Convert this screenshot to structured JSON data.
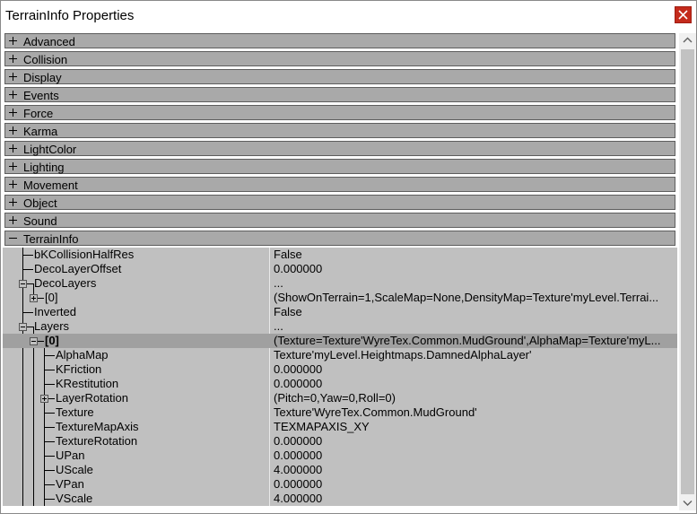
{
  "window": {
    "title": "TerrainInfo Properties"
  },
  "categories": [
    {
      "label": "Advanced",
      "expanded": false
    },
    {
      "label": "Collision",
      "expanded": false
    },
    {
      "label": "Display",
      "expanded": false
    },
    {
      "label": "Events",
      "expanded": false
    },
    {
      "label": "Force",
      "expanded": false
    },
    {
      "label": "Karma",
      "expanded": false
    },
    {
      "label": "LightColor",
      "expanded": false
    },
    {
      "label": "Lighting",
      "expanded": false
    },
    {
      "label": "Movement",
      "expanded": false
    },
    {
      "label": "Object",
      "expanded": false
    },
    {
      "label": "Sound",
      "expanded": false
    },
    {
      "label": "TerrainInfo",
      "expanded": true
    }
  ],
  "properties": [
    {
      "name": "bKCollisionHalfRes",
      "value": "False"
    },
    {
      "name": "DecoLayerOffset",
      "value": "0.000000"
    },
    {
      "name": "DecoLayers",
      "value": "..."
    },
    {
      "name": "[0]",
      "value": "(ShowOnTerrain=1,ScaleMap=None,DensityMap=Texture'myLevel.Terrai..."
    },
    {
      "name": "Inverted",
      "value": "False"
    },
    {
      "name": "Layers",
      "value": "..."
    },
    {
      "name": "[0]",
      "value": "(Texture=Texture'WyreTex.Common.MudGround',AlphaMap=Texture'myL..."
    },
    {
      "name": "AlphaMap",
      "value": "Texture'myLevel.Heightmaps.DamnedAlphaLayer'"
    },
    {
      "name": "KFriction",
      "value": "0.000000"
    },
    {
      "name": "KRestitution",
      "value": "0.000000"
    },
    {
      "name": "LayerRotation",
      "value": "(Pitch=0,Yaw=0,Roll=0)"
    },
    {
      "name": "Texture",
      "value": "Texture'WyreTex.Common.MudGround'"
    },
    {
      "name": "TextureMapAxis",
      "value": "TEXMAPAXIS_XY"
    },
    {
      "name": "TextureRotation",
      "value": "0.000000"
    },
    {
      "name": "UPan",
      "value": "0.000000"
    },
    {
      "name": "UScale",
      "value": "4.000000"
    },
    {
      "name": "VPan",
      "value": "0.000000"
    },
    {
      "name": "VScale",
      "value": "4.000000"
    }
  ]
}
